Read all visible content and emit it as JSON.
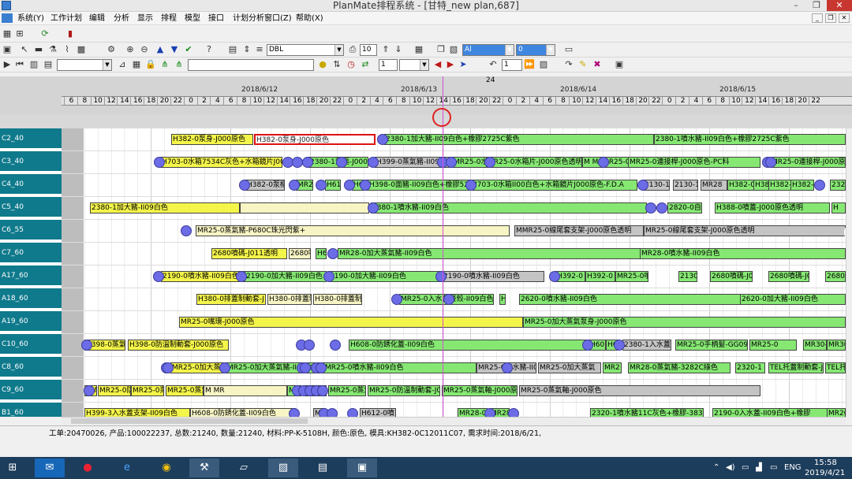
{
  "window": {
    "title": "PlanMate排程系统 - [甘特_new plan,687]",
    "minimize": "–",
    "restore": "❐",
    "close": "✕"
  },
  "menu": [
    "系统(Y)",
    "工作计划",
    "编辑",
    "分析",
    "显示",
    "排程",
    "模型",
    "接口",
    "计划分析窗口(Z)",
    "帮助(X)"
  ],
  "toolbar": {
    "dbl_combo": "DBL",
    "num_field": "10",
    "combo_a": "Al",
    "combo_b": "0",
    "num_field2": "1",
    "num_field3": "1"
  },
  "timeline": {
    "top_label": "24",
    "dates": [
      "2018/6/12",
      "2018/6/13",
      "2018/6/14",
      "2018/6/15"
    ],
    "hours": [
      "6",
      "8",
      "10",
      "12",
      "14",
      "16",
      "18",
      "20",
      "22",
      "0",
      "2",
      "4",
      "6",
      "8",
      "10",
      "12",
      "14",
      "16",
      "18",
      "20",
      "22",
      "0",
      "2",
      "4",
      "6",
      "8",
      "10",
      "12",
      "14",
      "16",
      "18",
      "20",
      "22",
      "0",
      "2",
      "4",
      "6",
      "8",
      "10",
      "12",
      "14",
      "16",
      "18",
      "20",
      "22",
      "0",
      "2",
      "4",
      "6",
      "8",
      "10",
      "12",
      "14",
      "16",
      "18",
      "20",
      "22"
    ]
  },
  "rows": [
    {
      "label": "C2_40",
      "bars": [
        {
          "c": "y",
          "t": "H382-0泵身-J000原色"
        },
        {
          "c": "sel",
          "t": "H382-0泵身-J000原色"
        },
        {
          "c": "g",
          "t": "2380-1加大豬-II09白色+橡膠2725C紫色"
        },
        {
          "c": "g",
          "t": "2380-1噴水豬-II09白色+橡膠2725C紫色"
        }
      ]
    },
    {
      "label": "C3_40",
      "bars": [
        {
          "c": "y",
          "t": "H703-0水箱7534C灰色+水箱鏡片J000"
        },
        {
          "c": "g",
          "t": "2380-1泵樞-J000原"
        },
        {
          "c": "gy",
          "t": "H399-0蒸氣豬-II09"
        },
        {
          "c": "g",
          "t": "MR25-0水"
        },
        {
          "c": "g",
          "t": "MR25-0水箱片-J000原色透明"
        },
        {
          "c": "g",
          "t": "M MR"
        },
        {
          "c": "g",
          "t": "MR25-0"
        },
        {
          "c": "g",
          "t": "MR25-0連接桿-J000原色-PC料"
        },
        {
          "c": "g",
          "t": "MR25-0連接桿-J000原色"
        }
      ]
    },
    {
      "label": "C4_40",
      "bars": [
        {
          "c": "gy",
          "t": "H382-0泵樞-J"
        },
        {
          "c": "g",
          "t": "MR2"
        },
        {
          "c": "g",
          "t": "H61"
        },
        {
          "c": "g",
          "t": "H6"
        },
        {
          "c": "g",
          "t": "H398-0面豬-II09白色+橡膠527"
        },
        {
          "c": "g",
          "t": "H703-0水箱II00白色+水箱鏡片J000原色-F.D.A"
        },
        {
          "c": "gy",
          "t": "2130-1"
        },
        {
          "c": "gy",
          "t": "2130-1"
        },
        {
          "c": "gy",
          "t": "MR28"
        },
        {
          "c": "g",
          "t": "H382-0"
        },
        {
          "c": "g",
          "t": "H38"
        },
        {
          "c": "g",
          "t": "H382-0"
        },
        {
          "c": "g",
          "t": "H382-0"
        },
        {
          "c": "g",
          "t": "2320"
        }
      ]
    },
    {
      "label": "C5_40",
      "bars": [
        {
          "c": "y",
          "t": "2380-1加大豬-II09白色"
        },
        {
          "c": "ly",
          "t": ""
        },
        {
          "c": "g",
          "t": "2380-1噴水豬-II09白色"
        },
        {
          "c": "g",
          "t": "2820-0自動"
        },
        {
          "c": "g",
          "t": "H388-0噴蓋-J000原色透明"
        },
        {
          "c": "g",
          "t": "H"
        }
      ]
    },
    {
      "label": "C6_55",
      "bars": [
        {
          "c": "ly",
          "t": "MR25-0蒸氣豬-P680C珠光閃紫+"
        },
        {
          "c": "gy",
          "t": "MMR25-0線尾套支架-J000原色透明"
        },
        {
          "c": "gy",
          "t": "MR25-0線尾套支架-J000原色透明"
        }
      ]
    },
    {
      "label": "C7_60",
      "bars": [
        {
          "c": "y",
          "t": "2680噴碼-J011透明"
        },
        {
          "c": "ly",
          "t": "2680噴"
        },
        {
          "c": "g",
          "t": "H6"
        },
        {
          "c": "g",
          "t": "MR28-0加大蒸氣豬-II09白色"
        },
        {
          "c": "g",
          "t": "MR28-0噴水豬-II09白色"
        }
      ]
    },
    {
      "label": "A17_60",
      "bars": [
        {
          "c": "y",
          "t": "2190-0噴水豬-II09白色"
        },
        {
          "c": "g",
          "t": "2190-0加大豬-II09白色"
        },
        {
          "c": "g",
          "t": "2190-0加大豬-II09白色"
        },
        {
          "c": "gy",
          "t": "2190-0噴水豬-II09白色"
        },
        {
          "c": "g",
          "t": "H392-0"
        },
        {
          "c": "g",
          "t": "H392-0"
        },
        {
          "c": "g",
          "t": "MR25-0噴"
        },
        {
          "c": "g",
          "t": "2130"
        },
        {
          "c": "g",
          "t": "2680噴碼-J011透明"
        },
        {
          "c": "g",
          "t": "2680噴碼-J011透明"
        },
        {
          "c": "g",
          "t": "2680噴"
        }
      ]
    },
    {
      "label": "A18_60",
      "bars": [
        {
          "c": "y",
          "t": "H380-0排蓋制動套-J"
        },
        {
          "c": "ly",
          "t": "H380-0排蓋制動"
        },
        {
          "c": "ly",
          "t": "H380-0排蓋制動"
        },
        {
          "c": "g",
          "t": "MR25-0入水蓋餐殼-II09白色"
        },
        {
          "c": "g",
          "t": "H3"
        },
        {
          "c": "g",
          "t": "2620-0噴水豬-II09白色"
        },
        {
          "c": "g",
          "t": "2620-0加大豬-II09白色"
        }
      ]
    },
    {
      "label": "A19_60",
      "bars": [
        {
          "c": "y",
          "t": "MR25-0嘴環-J000原色"
        },
        {
          "c": "g",
          "t": "MR25-0加大蒸氣泵身-J000原色"
        }
      ]
    },
    {
      "label": "C10_60",
      "bars": [
        {
          "c": "y",
          "t": "H398-0蒸氣豬"
        },
        {
          "c": "y",
          "t": "H398-0防溫制動套-J000原色"
        },
        {
          "c": "g",
          "t": "H608-0防銹化蓋-II09白色"
        },
        {
          "c": "g",
          "t": "H60"
        },
        {
          "c": "g",
          "t": "H608-0防"
        },
        {
          "c": "gy",
          "t": "2380-1入水蓋"
        },
        {
          "c": "g",
          "t": "MR25-0手柄髮-GG09"
        },
        {
          "c": "g",
          "t": "MR25-0"
        },
        {
          "c": "g",
          "t": "MR30-0"
        },
        {
          "c": "g",
          "t": "MR30-0"
        }
      ]
    },
    {
      "label": "C8_60",
      "bars": [
        {
          "c": "y",
          "t": "MR25-0加大蒸氣"
        },
        {
          "c": "g",
          "t": "MR25-0加大蒸氣豬-II09白色"
        },
        {
          "c": "g",
          "t": "MR25-0噴水豬-II09白色"
        },
        {
          "c": "gy",
          "t": "MR25-0噴水豬-II0"
        },
        {
          "c": "gy",
          "t": "MR25-0加大蒸氣"
        },
        {
          "c": "g",
          "t": "MR2"
        },
        {
          "c": "g",
          "t": "MR28-0蒸氣豬-3282C綠色"
        },
        {
          "c": "g",
          "t": "2320-1"
        },
        {
          "c": "g",
          "t": "TEL托蓋制動套-J"
        },
        {
          "c": "g",
          "t": "TEL托"
        }
      ]
    },
    {
      "label": "C9_60",
      "bars": [
        {
          "c": "y",
          "t": "M M MR25-0防"
        },
        {
          "c": "y",
          "t": "MR25-0防"
        },
        {
          "c": "y",
          "t": "MR25-0蒸"
        },
        {
          "c": "y",
          "t": "MR25-0蒸氣軸-J000原色"
        },
        {
          "c": "ly",
          "t": "M MR"
        },
        {
          "c": "g",
          "t": "MR25-0"
        },
        {
          "c": "g",
          "t": "MR25-0蒸"
        },
        {
          "c": "g",
          "t": "MR25-0蒸氣軸"
        },
        {
          "c": "g",
          "t": "MR25-0防溫制動套-J000"
        },
        {
          "c": "g",
          "t": "MR25-0蒸氣軸-J000原色透明"
        },
        {
          "c": "gy",
          "t": "MR25-0蒸氣軸-J000原色"
        }
      ]
    },
    {
      "label": "B1_60",
      "bars": [
        {
          "c": "y",
          "t": "H399-3入水蓋支架-II09白色"
        },
        {
          "c": "ly",
          "t": "H608-0防銹化蓋-II09白色"
        },
        {
          "c": "gy",
          "t": "MR"
        },
        {
          "c": "gy",
          "t": "H612-0噴"
        },
        {
          "c": "g",
          "t": "MR28-0線"
        },
        {
          "c": "g",
          "t": "MR28"
        },
        {
          "c": "g",
          "t": "2320-1噴水豬11C灰色+橡膠-383C綠"
        },
        {
          "c": "g",
          "t": "2190-0入水蓋-II09白色+橡膠"
        },
        {
          "c": "g",
          "t": "MR26-0"
        }
      ]
    }
  ],
  "status": "工单:20470026, 产品:100022237, 总数:21240, 数量:21240, 材料:PP-K-5108H, 颜色:原色, 模具:KH382-0C12011C07, 需求时间:2018/6/21,",
  "tray": {
    "time": "15:58",
    "date": "2019/4/21",
    "lang": "ENG"
  },
  "colors": {
    "row_label_bg": "#0f7a8c",
    "green": "#86e873",
    "yellow": "#f4f54a",
    "gray": "#c4c4c4",
    "taskbar": "#1d3d5c"
  }
}
